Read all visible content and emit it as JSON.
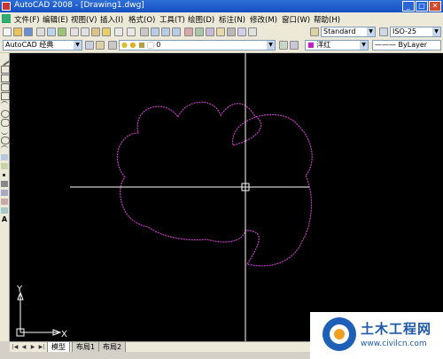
{
  "window": {
    "title": "AutoCAD 2008 - [Drawing1.dwg]"
  },
  "menu": {
    "items": [
      "文件(F)",
      "编辑(E)",
      "视图(V)",
      "插入(I)",
      "格式(O)",
      "工具(T)",
      "绘图(D)",
      "标注(N)",
      "修改(M)",
      "窗口(W)",
      "帮助(H)"
    ]
  },
  "toolbar": {
    "text_style": "Standard",
    "dim_style": "ISO-25"
  },
  "toolbar2": {
    "workspace": "AutoCAD 经典",
    "layer": "0",
    "color": "洋红",
    "linetype": "ByLayer"
  },
  "canvas": {
    "background": "#000000",
    "crosshair_color": "#ffffff",
    "shape_color": "#c040c0"
  },
  "ucs": {
    "x_label": "X",
    "y_label": "Y"
  },
  "tabs": [
    "模型",
    "布局1",
    "布局2"
  ],
  "watermark": {
    "name": "土木工程网",
    "url": "www.civilcn.com"
  }
}
